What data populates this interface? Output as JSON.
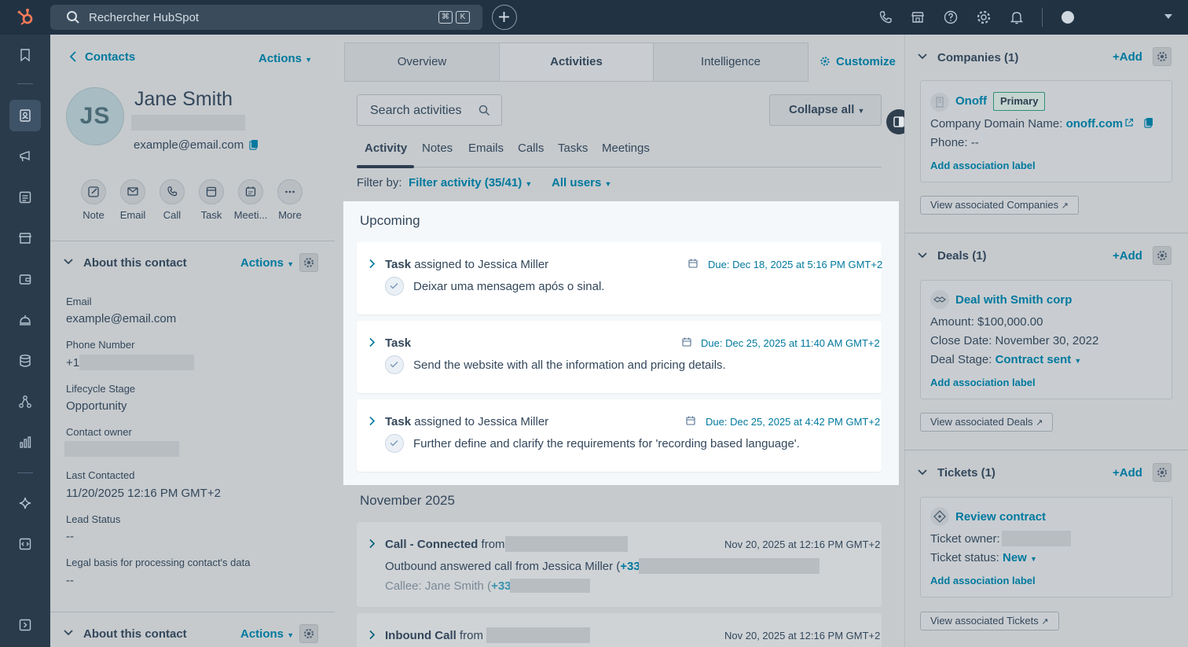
{
  "topbar": {
    "search_placeholder": "Rechercher HubSpot",
    "kbd_cmd": "⌘",
    "kbd_k": "K"
  },
  "left": {
    "back_label": "Contacts",
    "actions_label": "Actions",
    "avatar_initials": "JS",
    "name": "Jane Smith",
    "email": "example@email.com",
    "quick_actions": [
      "Note",
      "Email",
      "Call",
      "Task",
      "Meeti...",
      "More"
    ],
    "about_title": "About this contact",
    "about_actions": "Actions",
    "fields": {
      "email_label": "Email",
      "email_value": "example@email.com",
      "phone_label": "Phone Number",
      "phone_prefix": "+1",
      "lifecycle_label": "Lifecycle Stage",
      "lifecycle_value": "Opportunity",
      "owner_label": "Contact owner",
      "last_contacted_label": "Last Contacted",
      "last_contacted_value": "11/20/2025 12:16 PM GMT+2",
      "lead_status_label": "Lead Status",
      "lead_status_value": "--",
      "legal_label": "Legal basis for processing contact's data",
      "legal_value": "--"
    },
    "about_title_2": "About this contact",
    "about_actions_2": "Actions"
  },
  "middle": {
    "tabs": [
      "Overview",
      "Activities",
      "Intelligence"
    ],
    "customize_label": "Customize",
    "search_activities": "Search activities",
    "collapse_all": "Collapse all",
    "subtabs": [
      "Activity",
      "Notes",
      "Emails",
      "Calls",
      "Tasks",
      "Meetings"
    ],
    "filter_by": "Filter by:",
    "filter_activity": "Filter activity (35/41)",
    "all_users": "All users",
    "upcoming_title": "Upcoming",
    "tasks": [
      {
        "type": "Task",
        "assigned": "assigned to Jessica Miller",
        "due": "Due: Dec 18, 2025 at 5:16 PM GMT+2",
        "body": "Deixar uma mensagem após o sinal."
      },
      {
        "type": "Task",
        "assigned": "",
        "due": "Due: Dec 25, 2025 at 11:40 AM GMT+2",
        "body": "Send the website with all the information and pricing details."
      },
      {
        "type": "Task",
        "assigned": "assigned to Jessica Miller",
        "due": "Due: Dec 25, 2025 at 4:42 PM GMT+2",
        "body": "Further define and clarify the requirements for 'recording based language'."
      }
    ],
    "month_title": "November 2025",
    "call1": {
      "type": "Call - Connected",
      "from": "from",
      "time": "Nov 20, 2025 at 12:16 PM GMT+2",
      "line1_prefix": "Outbound answered call from Jessica Miller (",
      "line1_link": "+33",
      "line2_prefix": "Callee: Jane Smith (",
      "line2_link": "+33"
    },
    "call2": {
      "type": "Inbound Call",
      "from": "from",
      "time": "Nov 20, 2025 at 12:16 PM GMT+2"
    }
  },
  "right": {
    "companies": {
      "title": "Companies (1)",
      "add": "+Add",
      "name": "Onoff",
      "badge": "Primary",
      "domain_label": "Company Domain Name:",
      "domain_value": "onoff.com",
      "phone_label": "Phone:",
      "phone_value": "--",
      "assoc": "Add association label",
      "view": "View associated Companies"
    },
    "deals": {
      "title": "Deals (1)",
      "add": "+Add",
      "name": "Deal with Smith corp",
      "amount_label": "Amount:",
      "amount_value": "$100,000.00",
      "close_label": "Close Date:",
      "close_value": "November 30, 2022",
      "stage_label": "Deal Stage:",
      "stage_value": "Contract sent",
      "assoc": "Add association label",
      "view": "View associated Deals"
    },
    "tickets": {
      "title": "Tickets (1)",
      "add": "+Add",
      "name": "Review contract",
      "owner_label": "Ticket owner:",
      "status_label": "Ticket status:",
      "status_value": "New",
      "assoc": "Add association label",
      "view": "View associated Tickets"
    }
  }
}
